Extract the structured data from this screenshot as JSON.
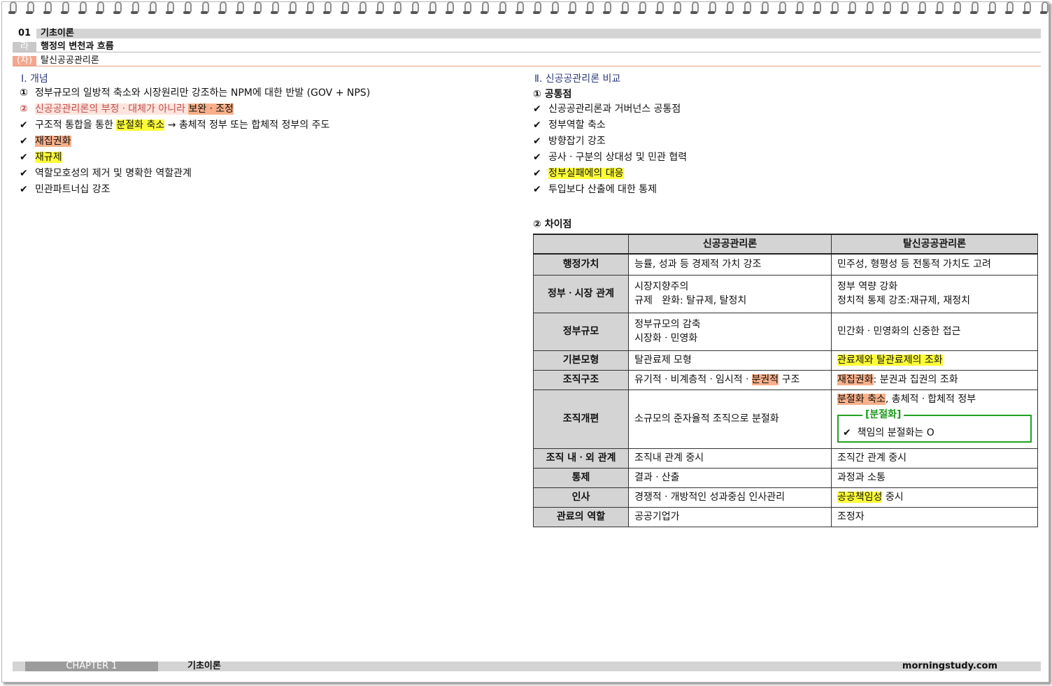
{
  "header": {
    "chapter_num": "01",
    "chapter_title": "기초이론",
    "section_mark": "라",
    "section_title": "행정의 변천과 흐름",
    "topic_mark": "(차)",
    "topic_title": "탈신공공관리론"
  },
  "left": {
    "heading": "Ⅰ. 개념",
    "items": [
      {
        "mark": "①",
        "text": "정부규모의 일방적 축소와 시장원리만 강조하는 NPM에 대한 반발 (GOV + NPS)"
      },
      {
        "mark": "②",
        "a": "신공공관리론의 부정ㆍ대체가 아니라 ",
        "b": "보완ㆍ조정"
      },
      {
        "mark": "✔",
        "a": "구조적 통합을 통한 ",
        "b": "분절화 축소",
        "c": " → 총체적 정부 또는 합체적 정부의 주도"
      },
      {
        "mark": "✔",
        "b": "재집권화"
      },
      {
        "mark": "✔",
        "b": "재규제"
      },
      {
        "mark": "✔",
        "text": "역할모호성의 제거 및 명확한 역할관계"
      },
      {
        "mark": "✔",
        "text": "민관파트너십 강조"
      }
    ]
  },
  "right": {
    "heading": "Ⅱ. 신공공관리론 비교",
    "common_title": "① 공통점",
    "common_items": [
      "신공공관리론과 거버넌스 공통점",
      "정부역할 축소",
      "방향잡기 강조",
      "공사ㆍ구분의 상대성 및 민관 협력",
      "정부실패에의 대응",
      "투입보다 산출에 대한 통제"
    ],
    "diff_title": "② 차이점",
    "table": {
      "col1": "신공공관리론",
      "col2": "탈신공공관리론",
      "rows": [
        {
          "label": "행정가치",
          "a": "능률, 성과 등 경제적 가치 강조",
          "b": "민주성, 형평성 등 전통적 가치도 고려"
        },
        {
          "label": "정부ㆍ시장 관계",
          "a1": "시장지향주의",
          "a2": "규제   완화: 탈규제, 탈정치",
          "b1": "정부 역량 강화",
          "b2": "정치적 통제 강조:재규제, 재정치"
        },
        {
          "label": "정부규모",
          "a1": "정부규모의 감축",
          "a2": "시장화ㆍ민영화",
          "b": "민간화ㆍ민영화의 신중한 접근"
        },
        {
          "label": "기본모형",
          "a": "탈관료제 모형",
          "b": "관료제와 탈관료제의 조화"
        },
        {
          "label": "조직구조",
          "a1": "유기적ㆍ비계층적ㆍ임시적ㆍ",
          "a2": "분권적",
          "a3": " 구조",
          "b1": "재집권화",
          "b2": ": 분권과 집권의 조화"
        },
        {
          "label": "조직개편",
          "a": "소규모의 준자율적 조직으로 분절화",
          "b1": "분절화 축소",
          "b2": ", 총체적ㆍ합체적 정부",
          "box_title": "[분절화]",
          "box_item": "책임의 분절화는 O"
        },
        {
          "label": "조직 내ㆍ외 관계",
          "a": "조직내 관계 중시",
          "b": "조직간 관계 중시"
        },
        {
          "label": "통제",
          "a": "결과ㆍ산출",
          "b": "과정과 소통"
        },
        {
          "label": "인사",
          "a": "경쟁적ㆍ개방적인 성과중심 인사관리",
          "b1": "공공책임성",
          "b2": " 중시"
        },
        {
          "label": "관료의 역할",
          "a": "공공기업가",
          "b": "조정자"
        }
      ]
    }
  },
  "footer": {
    "chapter": "CHAPTER 1",
    "title": "기초이론",
    "site": "morningstudy.com"
  },
  "colors": {
    "highlight_yellow": "#ffff38",
    "highlight_orange": "#f7b08a",
    "frame_green": "#22a122",
    "heading_blue": "#2c3b7a"
  }
}
